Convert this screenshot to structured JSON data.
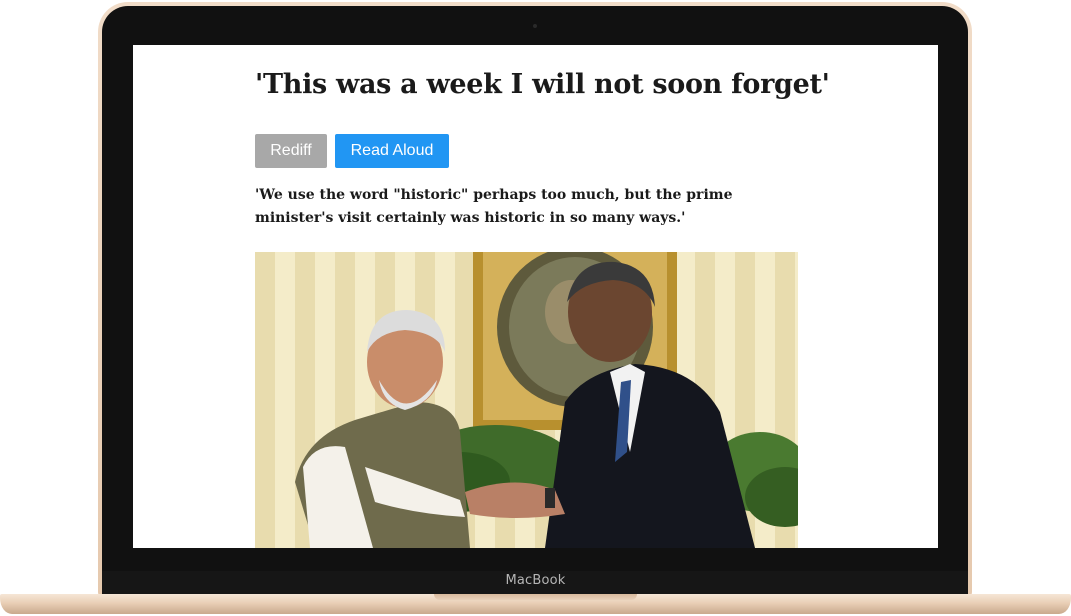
{
  "device": {
    "brand_label": "MacBook"
  },
  "article": {
    "headline": "'This was a week I will not soon forget'",
    "buttons": {
      "rediff_label": "Rediff",
      "read_aloud_label": "Read Aloud"
    },
    "summary": "'We use the word \"historic\" perhaps too much, but the prime minister's visit certainly was historic in so many ways.'"
  },
  "colors": {
    "rediff_button": "#a8a8a8",
    "read_aloud_button": "#2196f3",
    "laptop_body": "#e6c9ae",
    "bezel": "#111111"
  }
}
